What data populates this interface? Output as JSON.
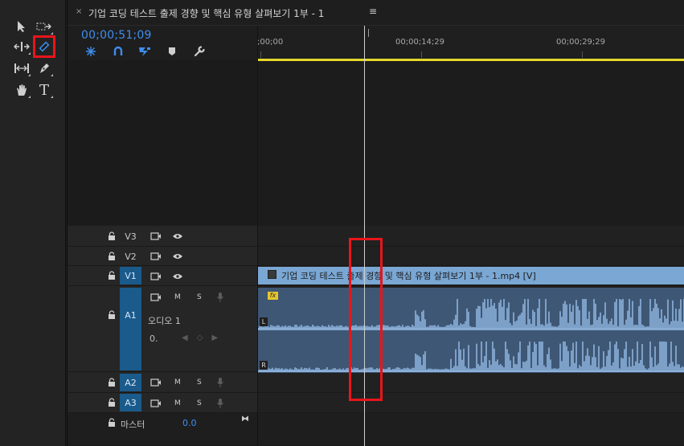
{
  "tools": {
    "items": [
      "selection-tool",
      "track-select-forward-tool",
      "ripple-edit-tool",
      "razor-tool",
      "slip-tool",
      "pen-tool",
      "hand-tool",
      "type-tool"
    ],
    "type_glyph": "T",
    "selected": "razor-tool"
  },
  "sequence": {
    "close_symbol": "×",
    "title": "기업 코딩 테스트 출제 경향 및 핵심 유형 살펴보기 1부 - 1",
    "menu_symbol": "≡",
    "timecode": "00;00;51;09"
  },
  "ruler": {
    "labels": [
      ";00;00",
      "00;00;14;29",
      "00;00;29;29"
    ]
  },
  "tracks": {
    "video": [
      {
        "name": "V3",
        "active": false
      },
      {
        "name": "V2",
        "active": false
      },
      {
        "name": "V1",
        "active": true
      }
    ],
    "audio": [
      {
        "name": "A1",
        "active": true,
        "m": "M",
        "s": "S"
      },
      {
        "name": "A2",
        "active": true,
        "m": "M",
        "s": "S"
      },
      {
        "name": "A3",
        "active": true,
        "m": "M",
        "s": "S"
      }
    ],
    "a1_label": "오디오 1",
    "vol_symbol": "0.",
    "keyframe_symbols": "◀◇▶",
    "master_label": "마스터",
    "master_value": "0.0",
    "master_symbol": "⧓"
  },
  "clips": {
    "video_label": "기업 코딩 테스트 출제 경향 및 핵심 유형 살펴보기 1부 - 1.mp4 [V]",
    "fx_label": "fx",
    "channel_left": "L",
    "channel_right": "R"
  },
  "colors": {
    "accent": "#3e8eef",
    "track_target": "#1a5b8c",
    "video_clip": "#7aa7d4",
    "audio_clip": "#3e5775",
    "highlight": "#e8151b",
    "work_area": "#e5d72b"
  }
}
